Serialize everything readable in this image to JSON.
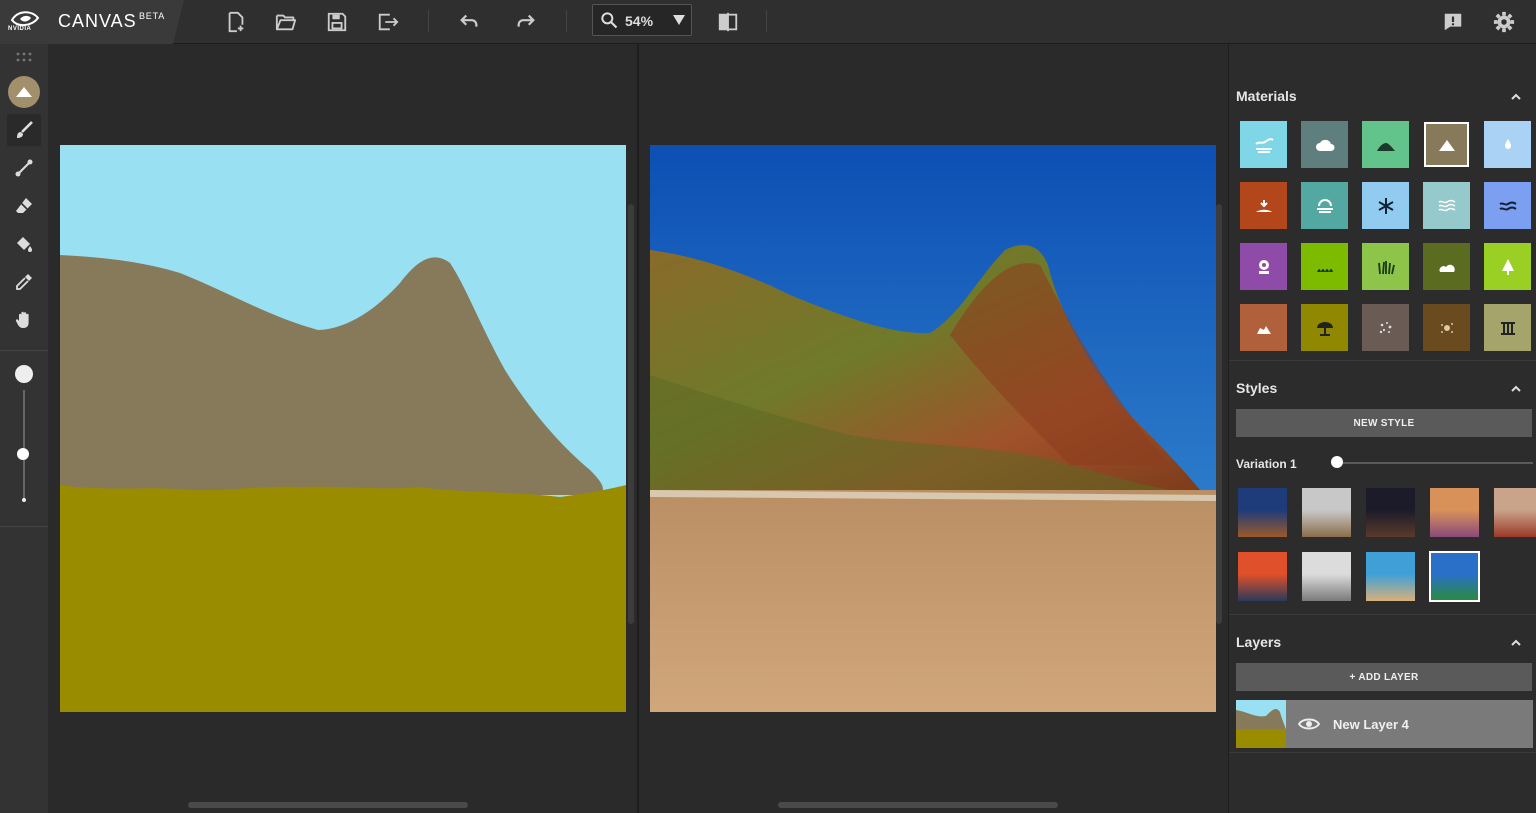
{
  "brand": {
    "name": "CANVAS",
    "badge": "BETA",
    "vendor": "NVIDIA"
  },
  "toolbar": {
    "buttons": [
      "new-file",
      "open-folder",
      "save",
      "export",
      "undo",
      "redo",
      "compare-toggle"
    ],
    "zoom": {
      "value": "54%"
    },
    "right_buttons": [
      "feedback",
      "settings"
    ]
  },
  "left_tools": [
    "material-selector",
    "brush",
    "line",
    "eraser",
    "fill-bucket",
    "eyedropper",
    "pan-hand",
    "brush-size"
  ],
  "colors": {
    "sky": "#9ae0f3",
    "mountain": "#867a5a",
    "ground": "#9a8c00",
    "accent_selected": "#a28f6b"
  },
  "materials": {
    "title": "Materials",
    "items": [
      {
        "name": "sea",
        "color": "#7fd6e6",
        "icon": "waves-icon"
      },
      {
        "name": "cloud",
        "color": "#5f7f7f",
        "icon": "cloud-icon"
      },
      {
        "name": "hill",
        "color": "#62c48a",
        "icon": "hill-icon"
      },
      {
        "name": "mountain",
        "color": "#867a5a",
        "icon": "mountain-icon",
        "selected": true
      },
      {
        "name": "water",
        "color": "#a9d2f5",
        "icon": "drop-icon"
      },
      {
        "name": "sand",
        "color": "#b3461a",
        "icon": "sand-icon"
      },
      {
        "name": "fog",
        "color": "#53a8a2",
        "icon": "fog-icon"
      },
      {
        "name": "snow",
        "color": "#92cbf0",
        "icon": "snowflake-icon"
      },
      {
        "name": "river",
        "color": "#95c9cb",
        "icon": "ripples-icon"
      },
      {
        "name": "lake",
        "color": "#7d9ff2",
        "icon": "wave-lines-icon"
      },
      {
        "name": "flower",
        "color": "#8e4ba8",
        "icon": "flower-icon"
      },
      {
        "name": "grass",
        "color": "#7cbb00",
        "icon": "grass-icon"
      },
      {
        "name": "tall-grass",
        "color": "#8cc54a",
        "icon": "tall-grass-icon"
      },
      {
        "name": "bush",
        "color": "#5b6b1f",
        "icon": "bush-icon"
      },
      {
        "name": "tree",
        "color": "#9ad023",
        "icon": "tree-icon"
      },
      {
        "name": "dirt",
        "color": "#b0603a",
        "icon": "rocks-icon"
      },
      {
        "name": "beach",
        "color": "#8f8800",
        "icon": "umbrella-icon"
      },
      {
        "name": "gravel",
        "color": "#6b5b55",
        "icon": "gravel-icon"
      },
      {
        "name": "rock",
        "color": "#6a4a1f",
        "icon": "rock-icon"
      },
      {
        "name": "ruins",
        "color": "#a5a46b",
        "icon": "pillar-icon"
      }
    ]
  },
  "styles": {
    "title": "Styles",
    "new_style": "NEW STYLE",
    "variation_label": "Variation 1",
    "variation_value": 0.0,
    "thumbs": [
      {
        "name": "desert-night",
        "top": "#1e3b7a",
        "bottom": "#9a5a2a"
      },
      {
        "name": "cloudy-sky",
        "top": "#c8c8c8",
        "bottom": "#8a6d4a"
      },
      {
        "name": "starry-arch",
        "top": "#1b1b2a",
        "bottom": "#5a3a2a"
      },
      {
        "name": "sunset-clouds",
        "top": "#d9915a",
        "bottom": "#8a4a7a"
      },
      {
        "name": "red-canyon",
        "top": "#c9a38a",
        "bottom": "#9b3a2a"
      },
      {
        "name": "ocean-sunset",
        "top": "#e0502a",
        "bottom": "#2a3a5a"
      },
      {
        "name": "snow-peaks",
        "top": "#dcdcdc",
        "bottom": "#7a7a7a"
      },
      {
        "name": "lake-valley",
        "top": "#3fa0d8",
        "bottom": "#d8b07a"
      },
      {
        "name": "mountain-lake",
        "top": "#2a6fc8",
        "bottom": "#2a8a3a",
        "selected": true
      }
    ]
  },
  "layers": {
    "title": "Layers",
    "add_label": "+ ADD LAYER",
    "items": [
      {
        "name": "New Layer 4",
        "visible": true
      }
    ]
  }
}
